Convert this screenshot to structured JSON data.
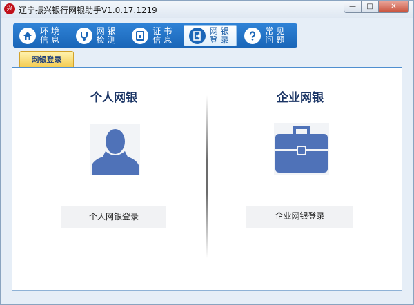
{
  "app": {
    "title": "辽宁振兴银行网银助手V1.0.17.1219",
    "logo_text": "兴"
  },
  "window_controls": {
    "minimize": "—",
    "maximize": "□",
    "close": "✕"
  },
  "toolbar": {
    "items": [
      {
        "label_top": "环境",
        "label_bottom": "信息",
        "icon": "house-icon",
        "glyph": "⌂"
      },
      {
        "label_top": "网银",
        "label_bottom": "检测",
        "icon": "stethoscope-icon",
        "glyph": "♥"
      },
      {
        "label_top": "证书",
        "label_bottom": "信息",
        "icon": "certificate-icon",
        "glyph": "▣"
      },
      {
        "label_top": "网银",
        "label_bottom": "登录",
        "icon": "login-icon",
        "glyph": "➔"
      },
      {
        "label_top": "常见",
        "label_bottom": "问题",
        "icon": "question-icon",
        "glyph": "?"
      }
    ],
    "active_index": 3
  },
  "tab": {
    "label": "网银登录"
  },
  "personal": {
    "title": "个人网银",
    "button": "个人网银登录",
    "icon": "person-icon"
  },
  "corporate": {
    "title": "企业网银",
    "button": "企业网银登录",
    "icon": "briefcase-icon"
  },
  "colors": {
    "accent_blue": "#1b66b8",
    "icon_blue": "#4f72b8",
    "tab_yellow": "#f3c94a",
    "title_navy": "#1b3565"
  }
}
